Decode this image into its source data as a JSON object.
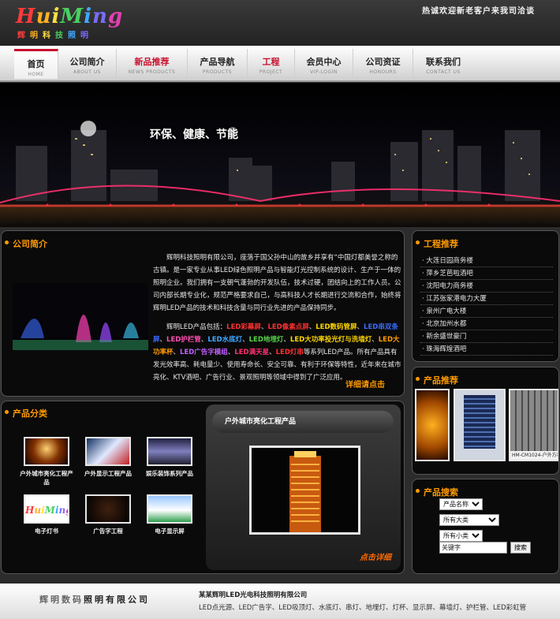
{
  "header": {
    "logo_text": "HuiMing",
    "logo_subtitle": "辉明科技照明",
    "welcome": "热诚欢迎新老客户来我司洽谈"
  },
  "nav": [
    {
      "label": "首页",
      "sub": "HOME"
    },
    {
      "label": "公司简介",
      "sub": "ABOUT US"
    },
    {
      "label": "新品推荐",
      "sub": "NEWS PRODUCTS"
    },
    {
      "label": "产品导航",
      "sub": "PRODUCTS"
    },
    {
      "label": "工程",
      "sub": "PROJECT"
    },
    {
      "label": "会员中心",
      "sub": "VIP-LOGIN"
    },
    {
      "label": "公司资证",
      "sub": "HONOURS"
    },
    {
      "label": "联系我们",
      "sub": "CONTACT US"
    }
  ],
  "banner": {
    "slogan": "环保、健康、节能"
  },
  "about": {
    "title": "公司简介",
    "para1": "辉明科技照明有限公司，座落于国父孙中山的故乡并享有“中国灯都美誉之称的古镇。是一家专业从事LED绿色照明产品与智能灯光控制系统的设计、生产于一体的照明企业。我们拥有一支朝气蓬勃的开发队伍，技术过硬，团结向上的工作人员。公司内部长期专业化，规范严格要求自己，与高科技人才长期进行交流和合作，始终将辉明LED产品的技术和科技含量与同行业先进的产品保持同步。",
    "para2_prefix": "辉明LED产品包括：",
    "products": [
      {
        "text": "LED彩幕屏",
        "color": "#ff3030"
      },
      {
        "text": "LED像素点屏",
        "color": "#ff3030"
      },
      {
        "text": "LED数码管屏",
        "color": "#ffd700"
      },
      {
        "text": "LED串双条屏",
        "color": "#3a6cff"
      },
      {
        "text": "LED护栏管",
        "color": "#ff4fb0"
      },
      {
        "text": "LED水底灯",
        "color": "#3fa9ff"
      },
      {
        "text": "LED地埋灯",
        "color": "#55d24a"
      },
      {
        "text": "LED大功率投光灯与洗墙灯",
        "color": "#ffd700"
      },
      {
        "text": "LED大功率杯",
        "color": "#ff9a00"
      },
      {
        "text": "LED广告字模组",
        "color": "#c060ff"
      },
      {
        "text": "LED满天星",
        "color": "#ff3070"
      },
      {
        "text": "LED灯串",
        "color": "#ff3030"
      }
    ],
    "para2_suffix": "等系列LED产品。所有产品具有发光效率高、耗电量少、使用寿命长、安全可靠、有利于环保等特性，近年来在城市亮化、KTV酒吧、广告行业、景观照明等领域中得到了广泛应用。",
    "more": "详细请点击"
  },
  "projects": {
    "title": "工程推荐",
    "items": [
      "大莲日园商务楼",
      "萍乡芝芭啦酒吧",
      "沈阳电力商务楼",
      "江苏张家港电力大厦",
      "泉州广电大楼",
      "北京加州水都",
      "新余盛世豪门",
      "珠海辉煌酒吧"
    ]
  },
  "recommend": {
    "title": "产品推荐",
    "caption": "HM-CM1024-户外方幕"
  },
  "categories": {
    "title": "产品分类",
    "items": [
      "户外城市亮化工程产品",
      "户外显示工程产品",
      "娱乐装饰系列产品",
      "电子灯书",
      "广告字工程",
      "电子显示屏"
    ]
  },
  "feature": {
    "title": "户外城市亮化工程产品",
    "more": "点击详细"
  },
  "search": {
    "title": "产品搜索",
    "field": "产品名称",
    "big_class": "所有大类",
    "small_class": "所有小类",
    "keyword": "关键字",
    "button": "搜索"
  },
  "footer": {
    "logo_light": "辉明数码",
    "logo_bold": "照明有限公司",
    "company": "某某辉明LED光电科技照明有限公司",
    "products": "LED点光源、LED广告字、LED吸顶灯、水底灯、串灯、地埋灯、灯杯、显示屏、幕墙灯、护栏管、LED彩虹管"
  },
  "colors": {
    "accent_orange": "#ff9a00",
    "nav_red": "#c8102e",
    "panel_bg": "#0a0a0a"
  }
}
